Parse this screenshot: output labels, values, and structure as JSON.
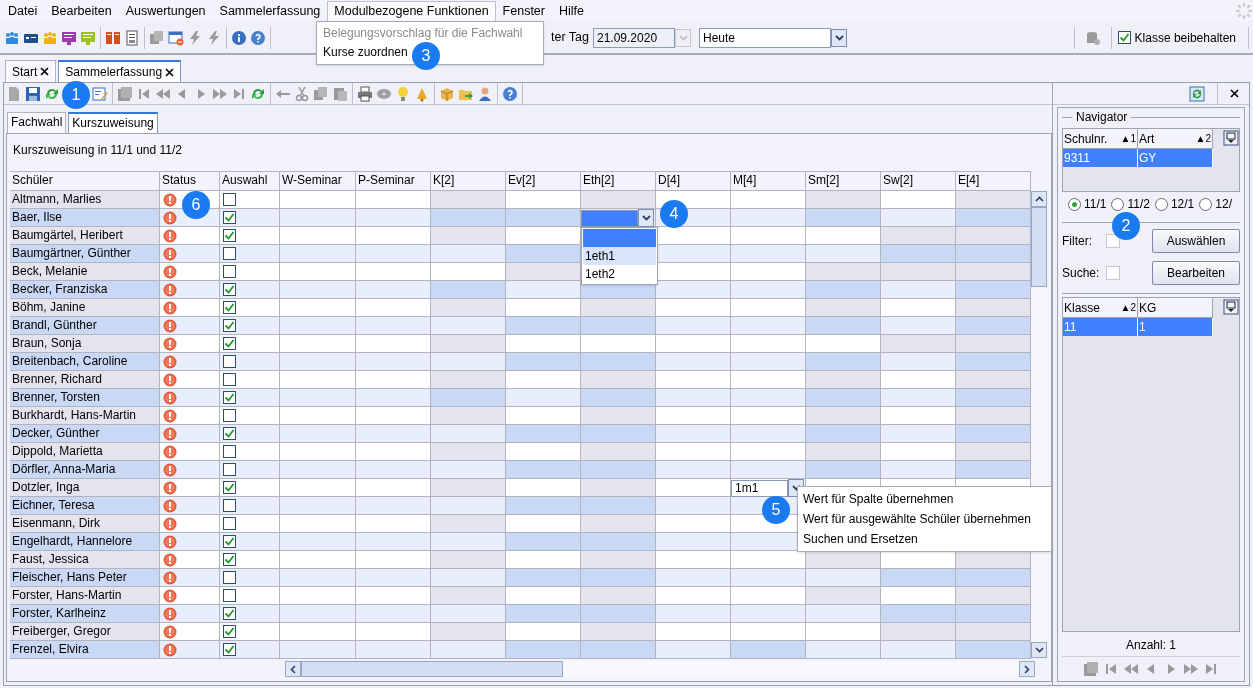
{
  "menu_bar": [
    {
      "label": "Datei",
      "selected": false
    },
    {
      "label": "Bearbeiten",
      "selected": false
    },
    {
      "label": "Auswertungen",
      "selected": false
    },
    {
      "label": "Sammelerfassung",
      "selected": false
    },
    {
      "label": "Modulbezogene Funktionen",
      "selected": true
    },
    {
      "label": "Fenster",
      "selected": false
    },
    {
      "label": "Hilfe",
      "selected": false
    }
  ],
  "open_menu": {
    "items": [
      {
        "label": "Belegungsvorschlag für die Fachwahl",
        "disabled": true
      },
      {
        "label": "Kurse zuordnen",
        "disabled": false
      }
    ]
  },
  "toolbar": {
    "day_label": "ter Tag",
    "date": "21.09.2020",
    "period": "Heute",
    "keep_class": {
      "label": "Klasse beibehalten",
      "checked": true
    }
  },
  "document_tabs": [
    {
      "label": "Start",
      "selected": false
    },
    {
      "label": "Sammelerfassung",
      "selected": true
    }
  ],
  "sub_tabs": [
    {
      "label": "Fachwahl",
      "selected": false
    },
    {
      "label": "Kurszuweisung",
      "selected": true
    }
  ],
  "title": "Kurszuweisung in 11/1 und 11/2",
  "grid": {
    "columns": [
      "Schüler",
      "Status",
      "Auswahl",
      "W-Seminar",
      "P-Seminar",
      "K[2]",
      "Ev[2]",
      "Eth[2]",
      "D[4]",
      "M[4]",
      "Sm[2]",
      "Sw[2]",
      "E[4]"
    ],
    "rows": [
      {
        "cells": [
          {
            "kind": "name",
            "text": "Altmann, Marlies"
          },
          {
            "kind": "status"
          },
          {
            "kind": "check",
            "checked": false
          },
          {
            "kind": "course",
            "shaded": false
          },
          {
            "kind": "course",
            "shaded": false
          },
          {
            "kind": "course",
            "shaded": true
          },
          {
            "kind": "course",
            "shaded": false
          },
          {
            "kind": "course",
            "shaded": true
          },
          {
            "kind": "course",
            "shaded": false
          },
          {
            "kind": "course",
            "shaded": false
          },
          {
            "kind": "course",
            "shaded": true
          },
          {
            "kind": "course",
            "shaded": false
          },
          {
            "kind": "course",
            "shaded": true
          }
        ]
      },
      {
        "cells": [
          {
            "kind": "name",
            "text": "Baer, Ilse"
          },
          {
            "kind": "status"
          },
          {
            "kind": "check",
            "checked": true
          },
          {
            "kind": "course",
            "shaded": false
          },
          {
            "kind": "course",
            "shaded": false
          },
          {
            "kind": "course",
            "shaded": true
          },
          {
            "kind": "course",
            "shaded": true
          },
          {
            "kind": "dropdown"
          },
          {
            "kind": "course",
            "shaded": false
          },
          {
            "kind": "course",
            "shaded": false
          },
          {
            "kind": "course",
            "shaded": true
          },
          {
            "kind": "course",
            "shaded": false
          },
          {
            "kind": "course",
            "shaded": true
          }
        ]
      },
      {
        "cells": [
          {
            "kind": "name",
            "text": "Baumgärtel, Heribert"
          },
          {
            "kind": "status"
          },
          {
            "kind": "check",
            "checked": true
          },
          {
            "kind": "course",
            "shaded": false
          },
          {
            "kind": "course",
            "shaded": false
          },
          {
            "kind": "course",
            "shaded": true
          },
          {
            "kind": "course",
            "shaded": false
          },
          {
            "kind": "course"
          },
          {
            "kind": "course",
            "shaded": false
          },
          {
            "kind": "course",
            "shaded": false
          },
          {
            "kind": "course",
            "shaded": false
          },
          {
            "kind": "course",
            "shaded": true
          },
          {
            "kind": "course",
            "shaded": true
          }
        ]
      },
      {
        "cells": [
          {
            "kind": "name",
            "text": "Baumgärtner, Günther"
          },
          {
            "kind": "status"
          },
          {
            "kind": "check",
            "checked": false
          },
          {
            "kind": "course",
            "shaded": false
          },
          {
            "kind": "course",
            "shaded": false
          },
          {
            "kind": "course",
            "shaded": false
          },
          {
            "kind": "course",
            "shaded": true
          },
          {
            "kind": "course"
          },
          {
            "kind": "course",
            "shaded": false
          },
          {
            "kind": "course",
            "shaded": false
          },
          {
            "kind": "course",
            "shaded": false
          },
          {
            "kind": "course",
            "shaded": true
          },
          {
            "kind": "course",
            "shaded": true
          }
        ]
      },
      {
        "cells": [
          {
            "kind": "name",
            "text": "Beck, Melanie"
          },
          {
            "kind": "status"
          },
          {
            "kind": "check",
            "checked": false
          },
          {
            "kind": "course",
            "shaded": false
          },
          {
            "kind": "course",
            "shaded": false
          },
          {
            "kind": "course",
            "shaded": false
          },
          {
            "kind": "course",
            "shaded": true
          },
          {
            "kind": "course"
          },
          {
            "kind": "course",
            "shaded": false
          },
          {
            "kind": "course",
            "shaded": false
          },
          {
            "kind": "course",
            "shaded": true
          },
          {
            "kind": "course",
            "shaded": true
          },
          {
            "kind": "course",
            "shaded": true
          }
        ]
      },
      {
        "cells": [
          {
            "kind": "name",
            "text": "Becker, Franziska"
          },
          {
            "kind": "status"
          },
          {
            "kind": "check",
            "checked": true
          },
          {
            "kind": "course",
            "shaded": false
          },
          {
            "kind": "course",
            "shaded": false
          },
          {
            "kind": "course",
            "shaded": true
          },
          {
            "kind": "course",
            "shaded": false
          },
          {
            "kind": "course",
            "shaded": true
          },
          {
            "kind": "course",
            "shaded": false
          },
          {
            "kind": "course",
            "shaded": false
          },
          {
            "kind": "course",
            "shaded": true
          },
          {
            "kind": "course",
            "shaded": false
          },
          {
            "kind": "course",
            "shaded": true
          }
        ]
      },
      {
        "cells": [
          {
            "kind": "name",
            "text": "Böhm, Janine"
          },
          {
            "kind": "status"
          },
          {
            "kind": "check",
            "checked": true
          },
          {
            "kind": "course",
            "shaded": false
          },
          {
            "kind": "course",
            "shaded": false
          },
          {
            "kind": "course",
            "shaded": true
          },
          {
            "kind": "course",
            "shaded": false
          },
          {
            "kind": "course",
            "shaded": true
          },
          {
            "kind": "course",
            "shaded": false
          },
          {
            "kind": "course",
            "shaded": false
          },
          {
            "kind": "course",
            "shaded": true
          },
          {
            "kind": "course",
            "shaded": false
          },
          {
            "kind": "course",
            "shaded": true
          }
        ]
      },
      {
        "cells": [
          {
            "kind": "name",
            "text": "Brandl, Günther"
          },
          {
            "kind": "status"
          },
          {
            "kind": "check",
            "checked": true
          },
          {
            "kind": "course",
            "shaded": false
          },
          {
            "kind": "course",
            "shaded": false
          },
          {
            "kind": "course",
            "shaded": false
          },
          {
            "kind": "course",
            "shaded": true
          },
          {
            "kind": "course",
            "shaded": true
          },
          {
            "kind": "course",
            "shaded": false
          },
          {
            "kind": "course",
            "shaded": false
          },
          {
            "kind": "course",
            "shaded": true
          },
          {
            "kind": "course",
            "shaded": false
          },
          {
            "kind": "course",
            "shaded": true
          }
        ]
      },
      {
        "cells": [
          {
            "kind": "name",
            "text": "Braun, Sonja"
          },
          {
            "kind": "status"
          },
          {
            "kind": "check",
            "checked": true
          },
          {
            "kind": "course",
            "shaded": false
          },
          {
            "kind": "course",
            "shaded": false
          },
          {
            "kind": "course",
            "shaded": true
          },
          {
            "kind": "course",
            "shaded": false
          },
          {
            "kind": "course",
            "shaded": false
          },
          {
            "kind": "course",
            "shaded": false
          },
          {
            "kind": "course",
            "shaded": false
          },
          {
            "kind": "course",
            "shaded": false
          },
          {
            "kind": "course",
            "shaded": true
          },
          {
            "kind": "course",
            "shaded": true
          }
        ]
      },
      {
        "cells": [
          {
            "kind": "name",
            "text": "Breitenbach, Caroline"
          },
          {
            "kind": "status"
          },
          {
            "kind": "check",
            "checked": false
          },
          {
            "kind": "course",
            "shaded": false
          },
          {
            "kind": "course",
            "shaded": false
          },
          {
            "kind": "course",
            "shaded": false
          },
          {
            "kind": "course",
            "shaded": true
          },
          {
            "kind": "course",
            "shaded": true
          },
          {
            "kind": "course",
            "shaded": false
          },
          {
            "kind": "course",
            "shaded": false
          },
          {
            "kind": "course",
            "shaded": true
          },
          {
            "kind": "course",
            "shaded": false
          },
          {
            "kind": "course",
            "shaded": true
          }
        ]
      },
      {
        "cells": [
          {
            "kind": "name",
            "text": "Brenner, Richard"
          },
          {
            "kind": "status"
          },
          {
            "kind": "check",
            "checked": false
          },
          {
            "kind": "course",
            "shaded": false
          },
          {
            "kind": "course",
            "shaded": false
          },
          {
            "kind": "course",
            "shaded": true
          },
          {
            "kind": "course",
            "shaded": false
          },
          {
            "kind": "course",
            "shaded": true
          },
          {
            "kind": "course",
            "shaded": false
          },
          {
            "kind": "course",
            "shaded": false
          },
          {
            "kind": "course",
            "shaded": true
          },
          {
            "kind": "course",
            "shaded": false
          },
          {
            "kind": "course",
            "shaded": true
          }
        ]
      },
      {
        "cells": [
          {
            "kind": "name",
            "text": "Brenner, Torsten"
          },
          {
            "kind": "status"
          },
          {
            "kind": "check",
            "checked": true
          },
          {
            "kind": "course",
            "shaded": false
          },
          {
            "kind": "course",
            "shaded": false
          },
          {
            "kind": "course",
            "shaded": true
          },
          {
            "kind": "course",
            "shaded": false
          },
          {
            "kind": "course",
            "shaded": true
          },
          {
            "kind": "course",
            "shaded": false
          },
          {
            "kind": "course",
            "shaded": false
          },
          {
            "kind": "course",
            "shaded": true
          },
          {
            "kind": "course",
            "shaded": false
          },
          {
            "kind": "course",
            "shaded": true
          }
        ]
      },
      {
        "cells": [
          {
            "kind": "name",
            "text": "Burkhardt, Hans-Martin"
          },
          {
            "kind": "status"
          },
          {
            "kind": "check",
            "checked": false
          },
          {
            "kind": "course",
            "shaded": false
          },
          {
            "kind": "course",
            "shaded": false
          },
          {
            "kind": "course",
            "shaded": true
          },
          {
            "kind": "course",
            "shaded": false
          },
          {
            "kind": "course",
            "shaded": true
          },
          {
            "kind": "course",
            "shaded": false
          },
          {
            "kind": "course",
            "shaded": false
          },
          {
            "kind": "course",
            "shaded": true
          },
          {
            "kind": "course",
            "shaded": false
          },
          {
            "kind": "course",
            "shaded": true
          }
        ]
      },
      {
        "cells": [
          {
            "kind": "name",
            "text": "Decker, Günther"
          },
          {
            "kind": "status"
          },
          {
            "kind": "check",
            "checked": true
          },
          {
            "kind": "course",
            "shaded": false
          },
          {
            "kind": "course",
            "shaded": false
          },
          {
            "kind": "course",
            "shaded": false
          },
          {
            "kind": "course",
            "shaded": true
          },
          {
            "kind": "course",
            "shaded": true
          },
          {
            "kind": "course",
            "shaded": false
          },
          {
            "kind": "course",
            "shaded": false
          },
          {
            "kind": "course",
            "shaded": true
          },
          {
            "kind": "course",
            "shaded": false
          },
          {
            "kind": "course",
            "shaded": true
          }
        ]
      },
      {
        "cells": [
          {
            "kind": "name",
            "text": "Dippold, Marietta"
          },
          {
            "kind": "status"
          },
          {
            "kind": "check",
            "checked": false
          },
          {
            "kind": "course",
            "shaded": false
          },
          {
            "kind": "course",
            "shaded": false
          },
          {
            "kind": "course",
            "shaded": true
          },
          {
            "kind": "course",
            "shaded": false
          },
          {
            "kind": "course",
            "shaded": true
          },
          {
            "kind": "course",
            "shaded": false
          },
          {
            "kind": "course",
            "shaded": false
          },
          {
            "kind": "course",
            "shaded": true
          },
          {
            "kind": "course",
            "shaded": false
          },
          {
            "kind": "course",
            "shaded": true
          }
        ]
      },
      {
        "cells": [
          {
            "kind": "name",
            "text": "Dörfler, Anna-Maria"
          },
          {
            "kind": "status"
          },
          {
            "kind": "check",
            "checked": false
          },
          {
            "kind": "course",
            "shaded": false
          },
          {
            "kind": "course",
            "shaded": false
          },
          {
            "kind": "course",
            "shaded": false
          },
          {
            "kind": "course",
            "shaded": true
          },
          {
            "kind": "course",
            "shaded": true
          },
          {
            "kind": "course",
            "shaded": false
          },
          {
            "kind": "course",
            "shaded": false
          },
          {
            "kind": "course",
            "shaded": true
          },
          {
            "kind": "course",
            "shaded": false
          },
          {
            "kind": "course",
            "shaded": true
          }
        ]
      },
      {
        "cells": [
          {
            "kind": "name",
            "text": "Dotzler, Inga"
          },
          {
            "kind": "status"
          },
          {
            "kind": "check",
            "checked": true
          },
          {
            "kind": "course",
            "shaded": false
          },
          {
            "kind": "course",
            "shaded": false
          },
          {
            "kind": "course",
            "shaded": true
          },
          {
            "kind": "course",
            "shaded": false
          },
          {
            "kind": "course",
            "shaded": true
          },
          {
            "kind": "course",
            "shaded": false
          },
          {
            "kind": "course",
            "combo": {
              "value": "1m1"
            }
          },
          {
            "kind": "course"
          },
          {
            "kind": "course"
          },
          {
            "kind": "course"
          }
        ]
      },
      {
        "cells": [
          {
            "kind": "name",
            "text": "Eichner, Teresa"
          },
          {
            "kind": "status"
          },
          {
            "kind": "check",
            "checked": false
          },
          {
            "kind": "course",
            "shaded": false
          },
          {
            "kind": "course",
            "shaded": false
          },
          {
            "kind": "course",
            "shaded": false
          },
          {
            "kind": "course",
            "shaded": true
          },
          {
            "kind": "course",
            "shaded": true
          },
          {
            "kind": "course",
            "shaded": false
          },
          {
            "kind": "course",
            "shaded": false
          },
          {
            "kind": "course"
          },
          {
            "kind": "course"
          },
          {
            "kind": "course"
          }
        ]
      },
      {
        "cells": [
          {
            "kind": "name",
            "text": "Eisenmann, Dirk"
          },
          {
            "kind": "status"
          },
          {
            "kind": "check",
            "checked": false
          },
          {
            "kind": "course",
            "shaded": false
          },
          {
            "kind": "course",
            "shaded": false
          },
          {
            "kind": "course",
            "shaded": true
          },
          {
            "kind": "course",
            "shaded": false
          },
          {
            "kind": "course",
            "shaded": true
          },
          {
            "kind": "course",
            "shaded": false
          },
          {
            "kind": "course",
            "shaded": false
          },
          {
            "kind": "course"
          },
          {
            "kind": "course"
          },
          {
            "kind": "course"
          }
        ]
      },
      {
        "cells": [
          {
            "kind": "name",
            "text": "Engelhardt, Hannelore"
          },
          {
            "kind": "status"
          },
          {
            "kind": "check",
            "checked": true
          },
          {
            "kind": "course",
            "shaded": false
          },
          {
            "kind": "course",
            "shaded": false
          },
          {
            "kind": "course",
            "shaded": false
          },
          {
            "kind": "course",
            "shaded": true
          },
          {
            "kind": "course",
            "shaded": true
          },
          {
            "kind": "course",
            "shaded": false
          },
          {
            "kind": "course",
            "shaded": false
          },
          {
            "kind": "course"
          },
          {
            "kind": "course"
          },
          {
            "kind": "course"
          }
        ]
      },
      {
        "cells": [
          {
            "kind": "name",
            "text": "Faust, Jessica"
          },
          {
            "kind": "status"
          },
          {
            "kind": "check",
            "checked": true
          },
          {
            "kind": "course",
            "shaded": false
          },
          {
            "kind": "course",
            "shaded": false
          },
          {
            "kind": "course",
            "shaded": true
          },
          {
            "kind": "course",
            "shaded": false
          },
          {
            "kind": "course",
            "shaded": true
          },
          {
            "kind": "course",
            "shaded": false
          },
          {
            "kind": "course",
            "shaded": false
          },
          {
            "kind": "course",
            "shaded": true
          },
          {
            "kind": "course",
            "shaded": false
          },
          {
            "kind": "course",
            "shaded": true
          }
        ]
      },
      {
        "cells": [
          {
            "kind": "name",
            "text": "Fleischer, Hans Peter"
          },
          {
            "kind": "status"
          },
          {
            "kind": "check",
            "checked": false
          },
          {
            "kind": "course",
            "shaded": false
          },
          {
            "kind": "course",
            "shaded": false
          },
          {
            "kind": "course",
            "shaded": false
          },
          {
            "kind": "course",
            "shaded": true
          },
          {
            "kind": "course",
            "shaded": true
          },
          {
            "kind": "course",
            "shaded": false
          },
          {
            "kind": "course",
            "shaded": false
          },
          {
            "kind": "course",
            "shaded": false
          },
          {
            "kind": "course",
            "shaded": true
          },
          {
            "kind": "course",
            "shaded": true
          }
        ]
      },
      {
        "cells": [
          {
            "kind": "name",
            "text": "Forster, Hans-Martin"
          },
          {
            "kind": "status"
          },
          {
            "kind": "check",
            "checked": false
          },
          {
            "kind": "course",
            "shaded": false
          },
          {
            "kind": "course",
            "shaded": false
          },
          {
            "kind": "course",
            "shaded": true
          },
          {
            "kind": "course",
            "shaded": false
          },
          {
            "kind": "course",
            "shaded": true
          },
          {
            "kind": "course",
            "shaded": false
          },
          {
            "kind": "course",
            "shaded": false
          },
          {
            "kind": "course",
            "shaded": true
          },
          {
            "kind": "course",
            "shaded": false
          },
          {
            "kind": "course",
            "shaded": true
          }
        ]
      },
      {
        "cells": [
          {
            "kind": "name",
            "text": "Forster, Karlheinz"
          },
          {
            "kind": "status"
          },
          {
            "kind": "check",
            "checked": true
          },
          {
            "kind": "course",
            "shaded": false
          },
          {
            "kind": "course",
            "shaded": false
          },
          {
            "kind": "course",
            "shaded": false
          },
          {
            "kind": "course",
            "shaded": true
          },
          {
            "kind": "course",
            "shaded": true
          },
          {
            "kind": "course",
            "shaded": false
          },
          {
            "kind": "course",
            "shaded": false
          },
          {
            "kind": "course",
            "shaded": false
          },
          {
            "kind": "course",
            "shaded": true
          },
          {
            "kind": "course",
            "shaded": true
          }
        ]
      },
      {
        "cells": [
          {
            "kind": "name",
            "text": "Freiberger, Gregor"
          },
          {
            "kind": "status"
          },
          {
            "kind": "check",
            "checked": true
          },
          {
            "kind": "course",
            "shaded": false
          },
          {
            "kind": "course",
            "shaded": false
          },
          {
            "kind": "course",
            "shaded": true
          },
          {
            "kind": "course",
            "shaded": false
          },
          {
            "kind": "course",
            "shaded": true
          },
          {
            "kind": "course",
            "shaded": false
          },
          {
            "kind": "course",
            "shaded": false
          },
          {
            "kind": "course",
            "shaded": false
          },
          {
            "kind": "course",
            "shaded": true
          },
          {
            "kind": "course",
            "shaded": true
          }
        ]
      },
      {
        "cells": [
          {
            "kind": "name",
            "text": "Frenzel, Elvira"
          },
          {
            "kind": "status"
          },
          {
            "kind": "check",
            "checked": true
          },
          {
            "kind": "course",
            "shaded": false
          },
          {
            "kind": "course",
            "shaded": false
          },
          {
            "kind": "course",
            "shaded": false
          },
          {
            "kind": "course",
            "shaded": true
          },
          {
            "kind": "course",
            "shaded": true
          },
          {
            "kind": "course",
            "shaded": false
          },
          {
            "kind": "course",
            "shaded": true
          },
          {
            "kind": "course",
            "shaded": false
          },
          {
            "kind": "course",
            "shaded": false
          },
          {
            "kind": "course",
            "shaded": true
          }
        ]
      }
    ]
  },
  "dropdown_list": {
    "options": [
      {
        "selected": true
      },
      {
        "label": "1eth1",
        "selected": false,
        "hovered": true
      },
      {
        "label": "1eth2",
        "selected": false
      }
    ]
  },
  "context_menu": {
    "items": [
      "Wert für Spalte übernehmen",
      "Wert für ausgewählte Schüler übernehmen",
      "Suchen und Ersetzen"
    ]
  },
  "navigator": {
    "title": "Navigator",
    "school_table": {
      "columns": [
        {
          "label": "Schulnr.",
          "sort": "▲1"
        },
        {
          "label": "Art",
          "sort": "▲2"
        }
      ],
      "rows": [
        {
          "cells": [
            "9311",
            "GY"
          ],
          "selected": true
        }
      ]
    },
    "terms": [
      {
        "label": "11/1",
        "selected": true
      },
      {
        "label": "11/2",
        "selected": false
      },
      {
        "label": "12/1",
        "selected": false
      },
      {
        "label": "12/",
        "selected": false
      }
    ],
    "filter": {
      "label": "Filter:",
      "checked": false,
      "button": "Auswählen"
    },
    "search": {
      "label": "Suche:",
      "checked": false,
      "button": "Bearbeiten"
    },
    "class_table": {
      "columns": [
        {
          "label": "Klasse",
          "sort": "▲2"
        },
        {
          "label": "KG"
        }
      ],
      "rows": [
        {
          "cells": [
            "11",
            "1"
          ],
          "selected": true
        }
      ]
    },
    "count": "Anzahl: 1"
  },
  "callouts": [
    "1",
    "2",
    "3",
    "4",
    "5",
    "6"
  ]
}
